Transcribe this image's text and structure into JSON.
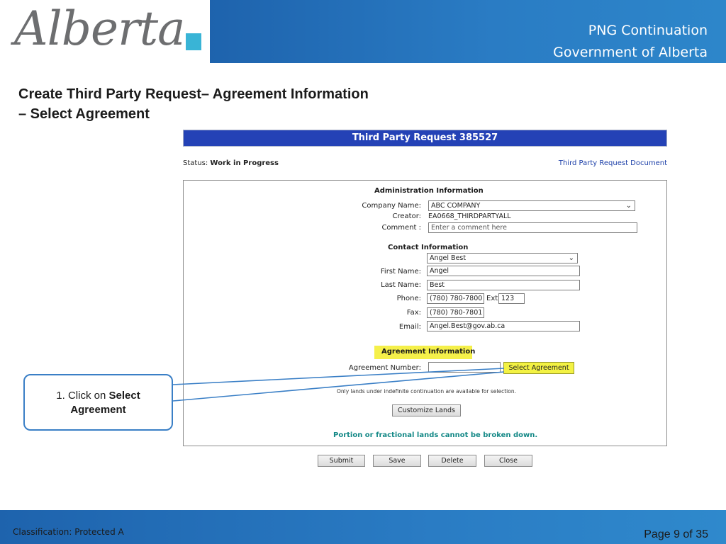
{
  "header": {
    "logo_text": "Alberta",
    "line1": "PNG Continuation",
    "line2": "Government of Alberta"
  },
  "slide_title": {
    "line1": "Create Third Party Request– Agreement Information",
    "line2": "– Select Agreement"
  },
  "form": {
    "title": "Third Party Request 385527",
    "status_label": "Status:",
    "status_value": "Work in Progress",
    "document_link": "Third Party Request Document",
    "admin": {
      "heading": "Administration Information",
      "company_label": "Company Name:",
      "company_value": "ABC COMPANY",
      "creator_label": "Creator:",
      "creator_value": "EA0668_THIRDPARTYALL",
      "comment_label": "Comment :",
      "comment_placeholder": "Enter a comment here"
    },
    "contact": {
      "heading": "Contact Information",
      "contact_select": "Angel Best",
      "first_label": "First Name:",
      "first_value": "Angel",
      "last_label": "Last Name:",
      "last_value": "Best",
      "phone_label": "Phone:",
      "phone_value": "(780) 780-7800",
      "ext_label": "Ext",
      "ext_value": "123",
      "fax_label": "Fax:",
      "fax_value": "(780) 780-7801",
      "email_label": "Email:",
      "email_value": "Angel.Best@gov.ab.ca"
    },
    "agreement": {
      "heading": "Agreement Information",
      "number_label": "Agreement Number:",
      "number_value": "",
      "select_button": "Select Agreement",
      "note": "Only lands under indefinite continuation are available for selection.",
      "customize_button": "Customize Lands",
      "portion_note": "Portion or fractional lands cannot be broken down."
    },
    "buttons": {
      "submit": "Submit",
      "save": "Save",
      "delete": "Delete",
      "close": "Close"
    }
  },
  "callout": {
    "prefix": "1. Click on ",
    "bold1": "Select",
    "bold2": "Agreement"
  },
  "footer": {
    "classification": "Classification: Protected A",
    "page": "Page 9 of 35"
  },
  "colors": {
    "header_blue": "#1e63ad",
    "form_title_bar": "#2442b6",
    "highlight_yellow": "#f3f243",
    "portion_teal": "#138886",
    "callout_border": "#3a7fc6"
  }
}
